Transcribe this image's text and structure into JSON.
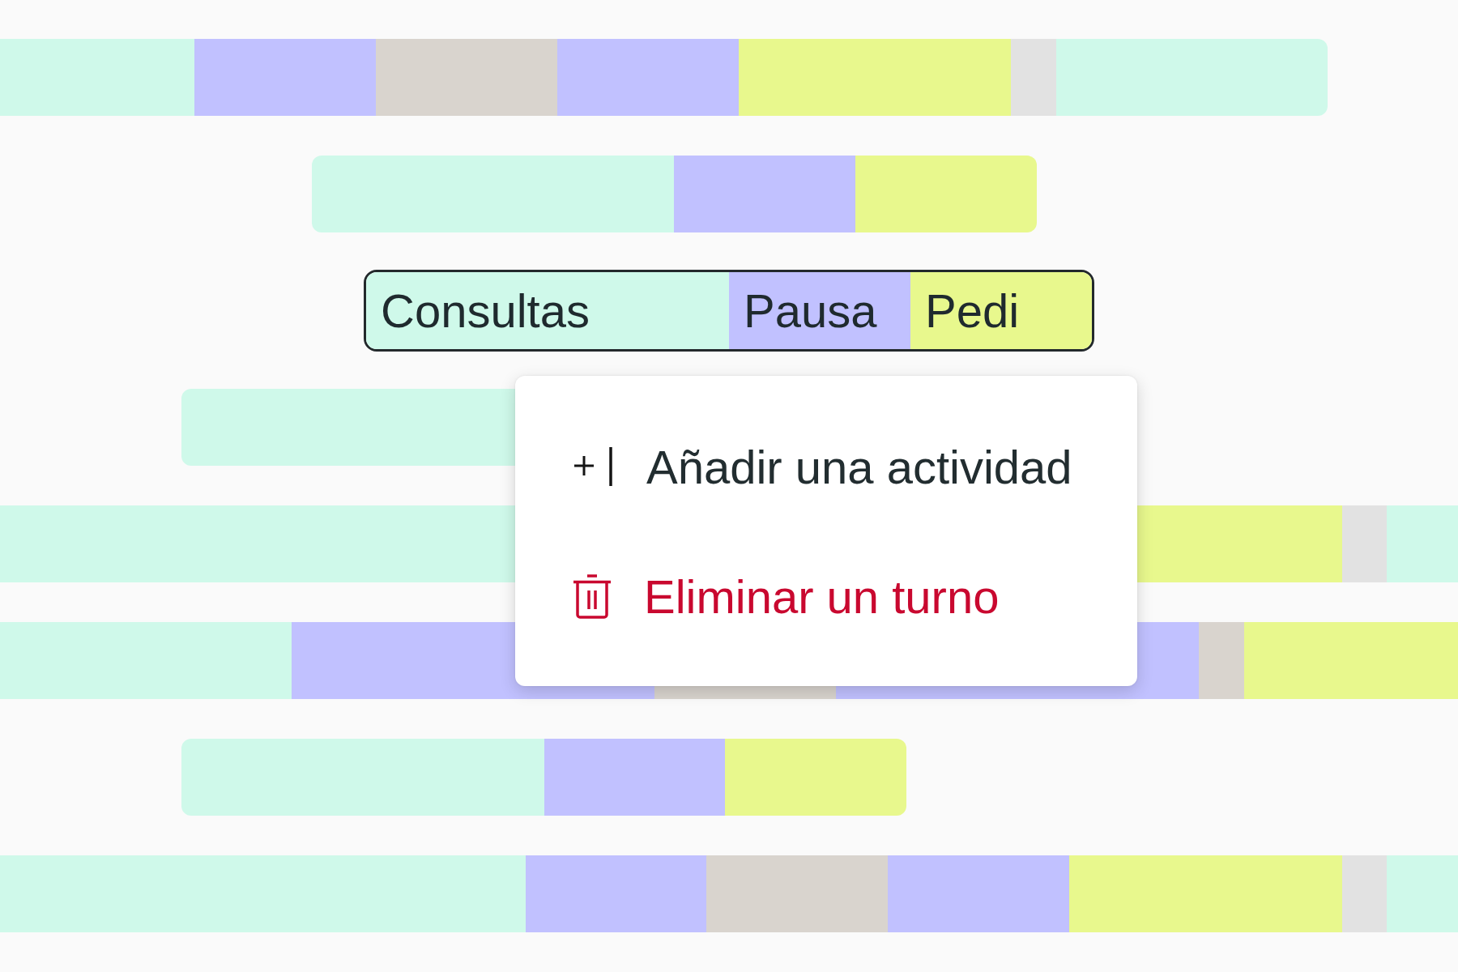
{
  "rows": [
    {
      "selected": false,
      "segments": [
        {
          "color": "#cff9ea"
        },
        {
          "color": "#c1c1ff"
        },
        {
          "color": "#d9d4ce"
        },
        {
          "color": "#c1c1ff"
        },
        {
          "color": "#e8f88d"
        },
        {
          "color": "#e2e2e2"
        },
        {
          "color": "#cff9ea"
        }
      ]
    },
    {
      "selected": false,
      "segments": [
        {
          "color": "#cff9ea"
        },
        {
          "color": "#c1c1ff"
        },
        {
          "color": "#e8f88d"
        }
      ]
    },
    {
      "selected": true,
      "segments": [
        {
          "color": "#cff9ea",
          "label": "Consultas"
        },
        {
          "color": "#c1c1ff",
          "label": "Pausa"
        },
        {
          "color": "#e8f88d",
          "label": "Pedi"
        }
      ]
    },
    {
      "selected": false,
      "segments": [
        {
          "color": "#cff9ea"
        }
      ]
    },
    {
      "selected": false,
      "segments": [
        {
          "color": "#cff9ea"
        },
        {
          "color": "#e8f88d"
        },
        {
          "color": "#e2e2e2"
        },
        {
          "color": "#cff9ea"
        }
      ]
    },
    {
      "selected": false,
      "segments": [
        {
          "color": "#cff9ea"
        },
        {
          "color": "#c1c1ff"
        },
        {
          "color": "#d9d4ce"
        },
        {
          "color": "#c1c1ff"
        },
        {
          "color": "#d9d4ce"
        },
        {
          "color": "#e8f88d"
        }
      ]
    },
    {
      "selected": false,
      "segments": [
        {
          "color": "#cff9ea"
        },
        {
          "color": "#c1c1ff"
        },
        {
          "color": "#e8f88d"
        }
      ]
    },
    {
      "selected": false,
      "segments": [
        {
          "color": "#cff9ea"
        },
        {
          "color": "#c1c1ff"
        },
        {
          "color": "#d9d4ce"
        },
        {
          "color": "#c1c1ff"
        },
        {
          "color": "#e8f88d"
        },
        {
          "color": "#e2e2e2"
        },
        {
          "color": "#cff9ea"
        }
      ]
    }
  ],
  "context_menu": {
    "items": [
      {
        "kind": "add",
        "label": "Añadir una actividad"
      },
      {
        "kind": "delete",
        "label": "Eliminar un turno"
      }
    ]
  }
}
